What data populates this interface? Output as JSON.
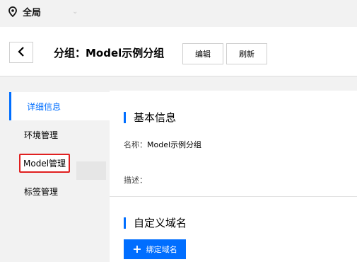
{
  "topbar": {
    "region_label": "全局"
  },
  "header": {
    "title": "分组：Model示例分组",
    "edit_label": "编辑",
    "refresh_label": "刷新"
  },
  "sidebar": {
    "items": [
      {
        "label": "详细信息",
        "active": true
      },
      {
        "label": "环境管理"
      },
      {
        "label": "Model管理",
        "highlighted": true
      },
      {
        "label": "标签管理"
      }
    ]
  },
  "basic_info": {
    "title": "基本信息",
    "name_key": "名称：",
    "name_value": "Model示例分组",
    "desc_key": "描述："
  },
  "custom_domain": {
    "title": "自定义域名",
    "bind_button": "绑定域名"
  },
  "colors": {
    "accent": "#006eff",
    "highlight_border": "#e02020"
  }
}
